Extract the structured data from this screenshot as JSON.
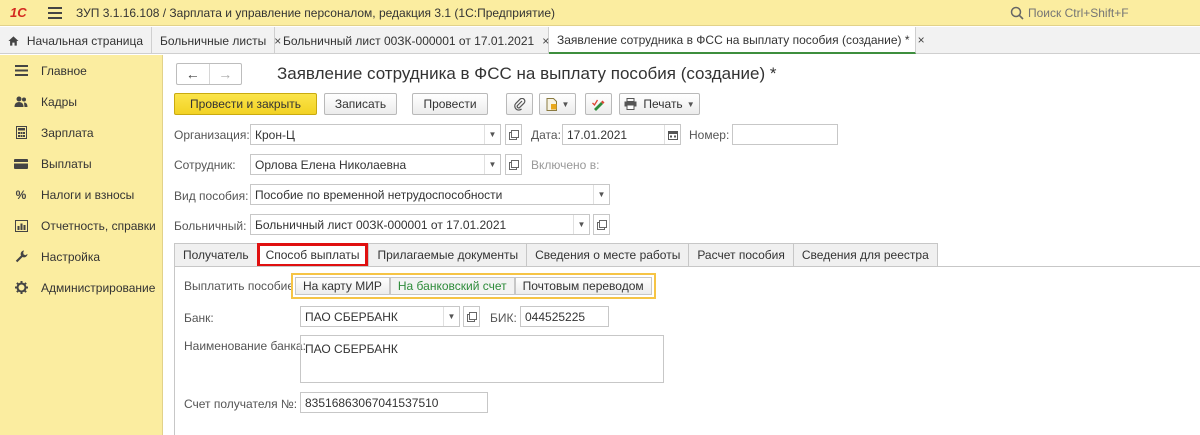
{
  "titlebar": {
    "logo": "1С",
    "title": "ЗУП 3.1.16.108 / Зарплата и управление персоналом, редакция 3.1  (1С:Предприятие)",
    "search_placeholder": "Поиск Ctrl+Shift+F"
  },
  "tabs": {
    "home": "Начальная страница",
    "items": [
      {
        "label": "Больничные листы",
        "close": "×"
      },
      {
        "label": "Больничный лист 00ЗК-000001 от 17.01.2021",
        "close": "×"
      },
      {
        "label": "Заявление сотрудника в ФСС на выплату пособия (создание) *",
        "close": "×"
      }
    ]
  },
  "sidebar": {
    "items": [
      {
        "label": "Главное",
        "icon": "menu-icon"
      },
      {
        "label": "Кадры",
        "icon": "people-icon"
      },
      {
        "label": "Зарплата",
        "icon": "calculator-icon"
      },
      {
        "label": "Выплаты",
        "icon": "wallet-icon"
      },
      {
        "label": "Налоги и взносы",
        "icon": "percent-icon"
      },
      {
        "label": "Отчетность, справки",
        "icon": "chart-icon"
      },
      {
        "label": "Настройка",
        "icon": "wrench-icon"
      },
      {
        "label": "Администрирование",
        "icon": "gear-icon"
      }
    ]
  },
  "document": {
    "title": "Заявление сотрудника в ФСС на выплату пособия (создание) *",
    "nav_back": "←",
    "nav_forward": "→"
  },
  "toolbar": {
    "post_close": "Провести и закрыть",
    "save": "Записать",
    "post": "Провести",
    "print": "Печать"
  },
  "form": {
    "org_label": "Организация:",
    "org_value": "Крон-Ц",
    "date_label": "Дата:",
    "date_value": "17.01.2021",
    "number_label": "Номер:",
    "number_value": "",
    "employee_label": "Сотрудник:",
    "employee_value": "Орлова Елена Николаевна",
    "included_label": "Включено в:",
    "benefit_label": "Вид пособия:",
    "benefit_value": "Пособие по временной нетрудоспособности",
    "sick_label": "Больничный:",
    "sick_value": "Больничный лист 00ЗК-000001 от 17.01.2021"
  },
  "form_tabs": [
    "Получатель",
    "Способ выплаты",
    "Прилагаемые документы",
    "Сведения о месте работы",
    "Расчет пособия",
    "Сведения для реестра"
  ],
  "payment": {
    "pay_label": "Выплатить пособие:",
    "options": [
      "На карту МИР",
      "На банковский счет",
      "Почтовым переводом"
    ],
    "selected_option": "На банковский счет",
    "bank_label": "Банк:",
    "bank_value": "ПАО СБЕРБАНК",
    "bik_label": "БИК:",
    "bik_value": "044525225",
    "bank_name_label": "Наименование банка:",
    "bank_name_value": "ПАО СБЕРБАНК",
    "account_label": "Счет получателя №:",
    "account_value": "83516863067041537510"
  },
  "colors": {
    "sidebar_bg": "#fbeda0",
    "primary_button": "#f2d224",
    "selected_text": "#2e8b3a",
    "highlight_border": "#e01010"
  }
}
